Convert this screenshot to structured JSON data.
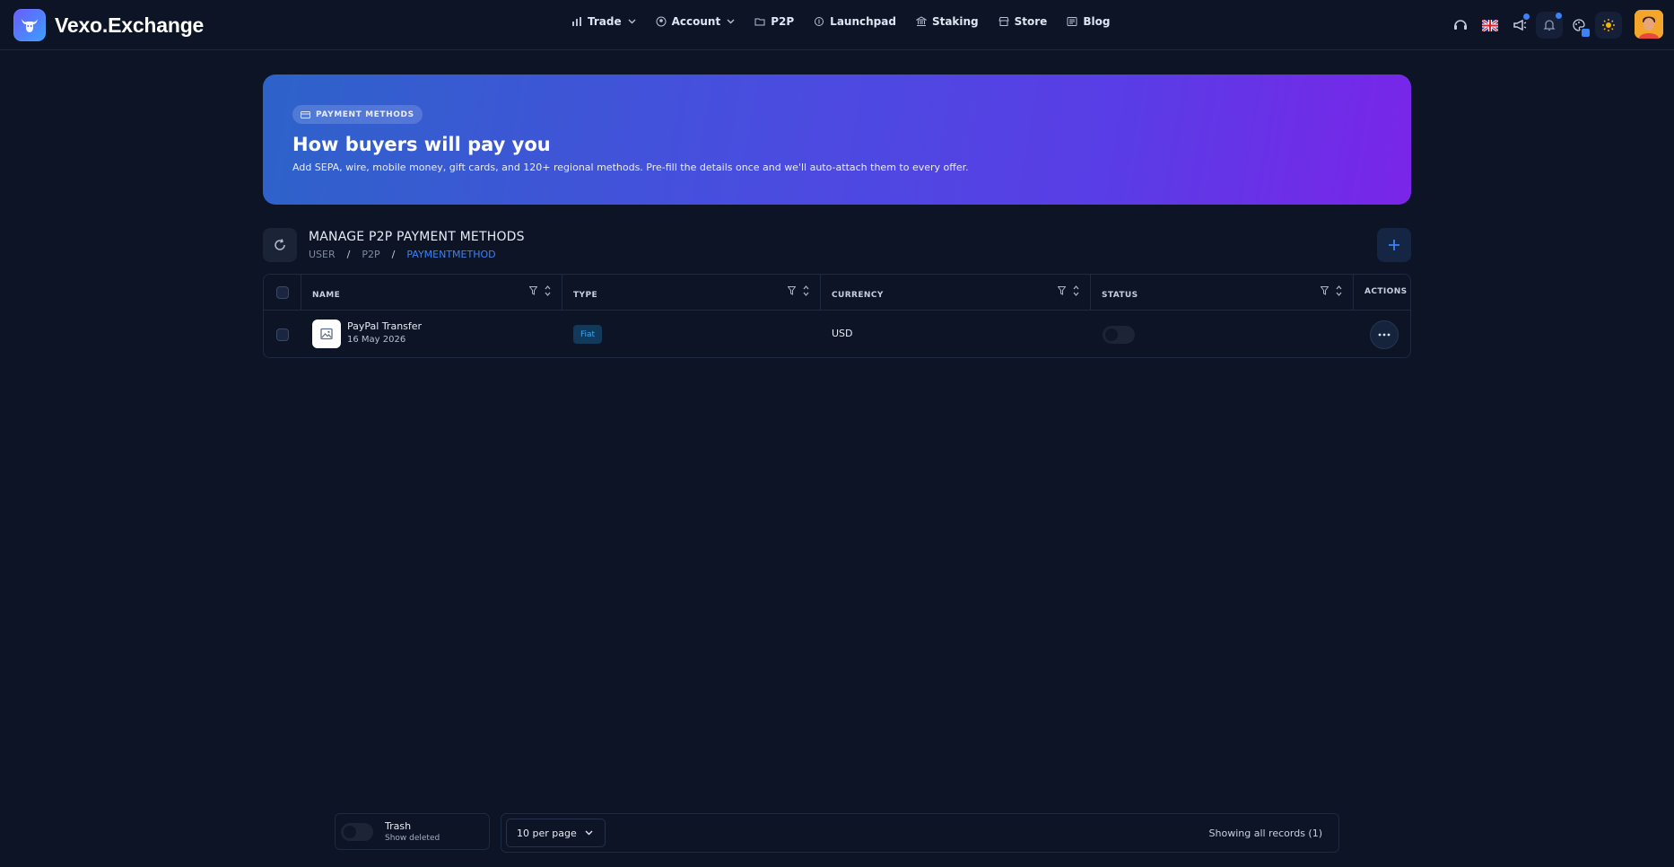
{
  "app": {
    "brand": "Vexo.Exchange",
    "accent": "#3b82f6"
  },
  "nav": {
    "items": [
      {
        "label": "Trade",
        "icon": "bar-chart-icon",
        "dropdown": true
      },
      {
        "label": "Account",
        "icon": "user-group-icon",
        "dropdown": true
      },
      {
        "label": "P2P",
        "icon": "folder-icon",
        "dropdown": false
      },
      {
        "label": "Launchpad",
        "icon": "coin-icon",
        "dropdown": false
      },
      {
        "label": "Staking",
        "icon": "bank-icon",
        "dropdown": false
      },
      {
        "label": "Store",
        "icon": "store-icon",
        "dropdown": false
      },
      {
        "label": "Blog",
        "icon": "newspaper-icon",
        "dropdown": false
      }
    ]
  },
  "hero": {
    "badge": "PAYMENT METHODS",
    "title": "How buyers will pay you",
    "subtitle": "Add SEPA, wire, mobile money, gift cards, and 120+ regional methods. Pre-fill the details once and we'll auto-attach them to every offer."
  },
  "manage": {
    "title": "MANAGE P2P PAYMENT METHODS",
    "breadcrumb": [
      "USER",
      "P2P",
      "PAYMENTMETHOD"
    ]
  },
  "table": {
    "columns": [
      "NAME",
      "TYPE",
      "CURRENCY",
      "STATUS",
      "ACTIONS"
    ],
    "rows": [
      {
        "name": "PayPal Transfer",
        "date": "16 May 2026",
        "type": "Fiat",
        "currency": "USD",
        "status_on": false
      }
    ]
  },
  "footer": {
    "trash_label": "Trash",
    "trash_sub": "Show deleted",
    "per_page": "10 per page",
    "records": "Showing all records (1)"
  }
}
